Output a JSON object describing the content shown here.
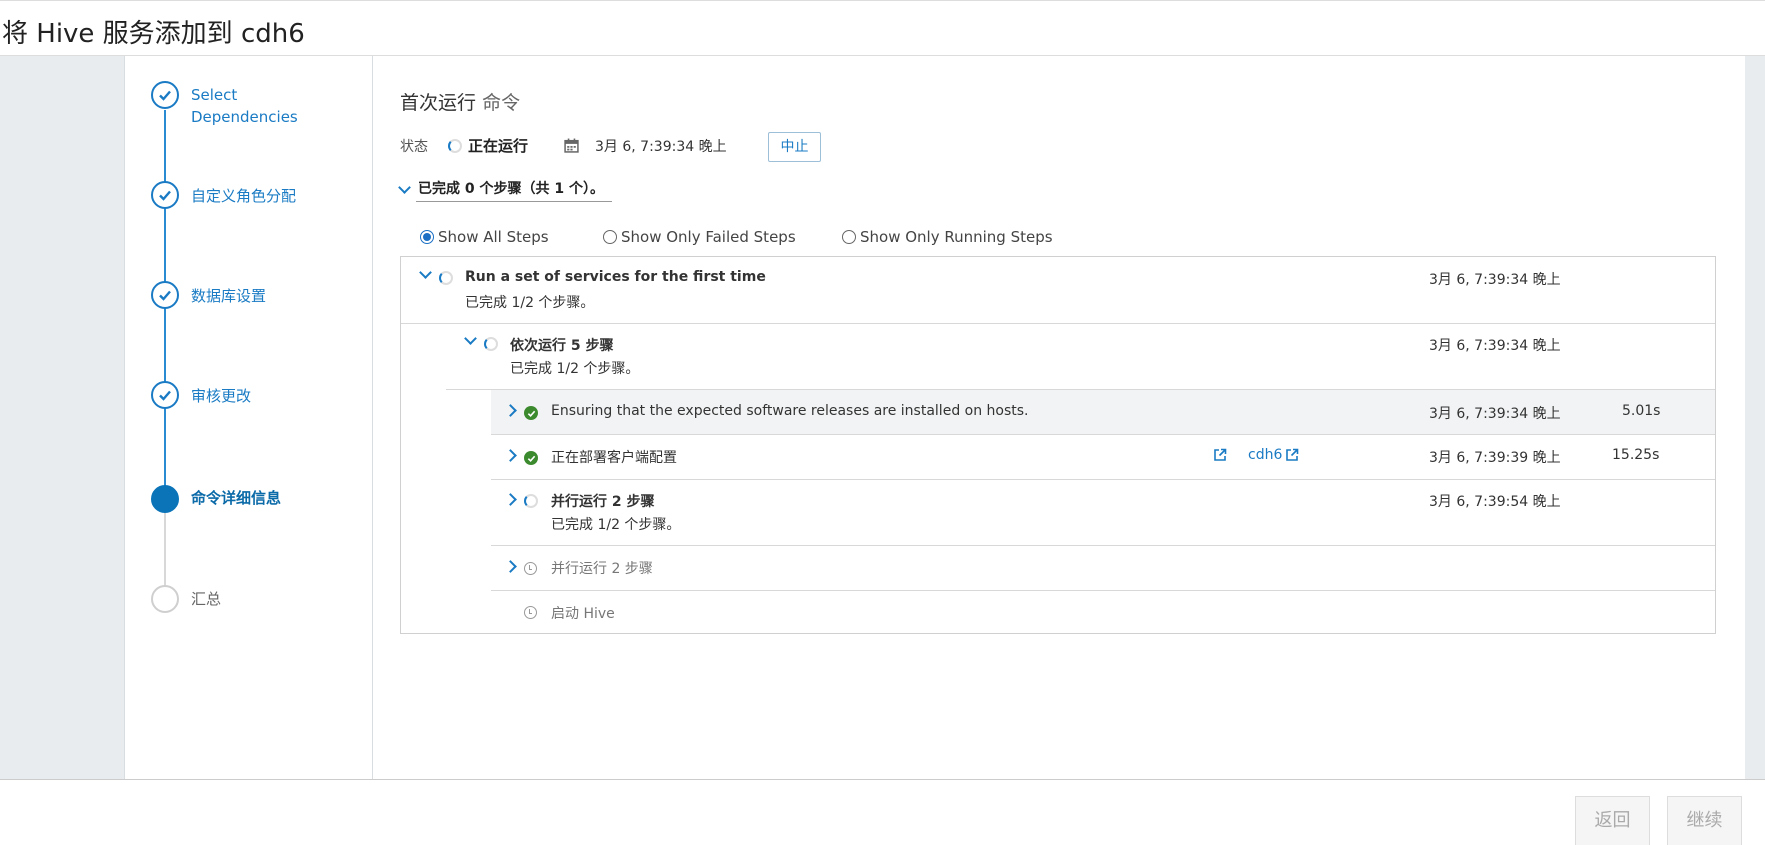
{
  "header": {
    "title": "将 Hive 服务添加到 cdh6"
  },
  "sidebar": {
    "steps": [
      {
        "label_line1": "Select",
        "label_line2": "Dependencies",
        "state": "done"
      },
      {
        "label": "自定义角色分配",
        "state": "done"
      },
      {
        "label": "数据库设置",
        "state": "done"
      },
      {
        "label": "审核更改",
        "state": "done"
      },
      {
        "label": "命令详细信息",
        "state": "active"
      },
      {
        "label": "汇总",
        "state": "todo"
      }
    ]
  },
  "command": {
    "title": "首次运行",
    "title_sub": "命令",
    "status_label": "状态",
    "status_value": "正在运行",
    "timestamp": "3月 6, 7:39:34 晚上",
    "abort_label": "中止",
    "summary": "已完成 0 个步骤（共 1 个）。"
  },
  "filters": {
    "all": "Show All Steps",
    "failed": "Show Only Failed Steps",
    "running": "Show Only Running Steps",
    "selected": "all"
  },
  "steps": {
    "root": {
      "title": "Run a set of services for the first time",
      "progress": "已完成 1/2 个步骤。",
      "time": "3月 6, 7:39:34 晚上"
    },
    "seq": {
      "title": "依次运行 5 步骤",
      "progress": "已完成 1/2 个步骤。",
      "time": "3月 6, 7:39:34 晚上"
    },
    "s1": {
      "title": "Ensuring that the expected software releases are installed on hosts.",
      "time": "3月 6, 7:39:34 晚上",
      "duration": "5.01s"
    },
    "s2": {
      "title": "正在部署客户端配置",
      "link": "cdh6",
      "time": "3月 6, 7:39:39 晚上",
      "duration": "15.25s"
    },
    "s3": {
      "title": "并行运行 2 步骤",
      "progress": "已完成 1/2 个步骤。",
      "time": "3月 6, 7:39:54 晚上"
    },
    "s4": {
      "title": "并行运行 2 步骤"
    },
    "s5": {
      "title": "启动 Hive"
    }
  },
  "footer": {
    "back": "返回",
    "continue": "继续"
  },
  "colors": {
    "accent": "#1a7bc4",
    "success": "#3c8a2e",
    "sidebar_bg": "#e8ecef"
  }
}
